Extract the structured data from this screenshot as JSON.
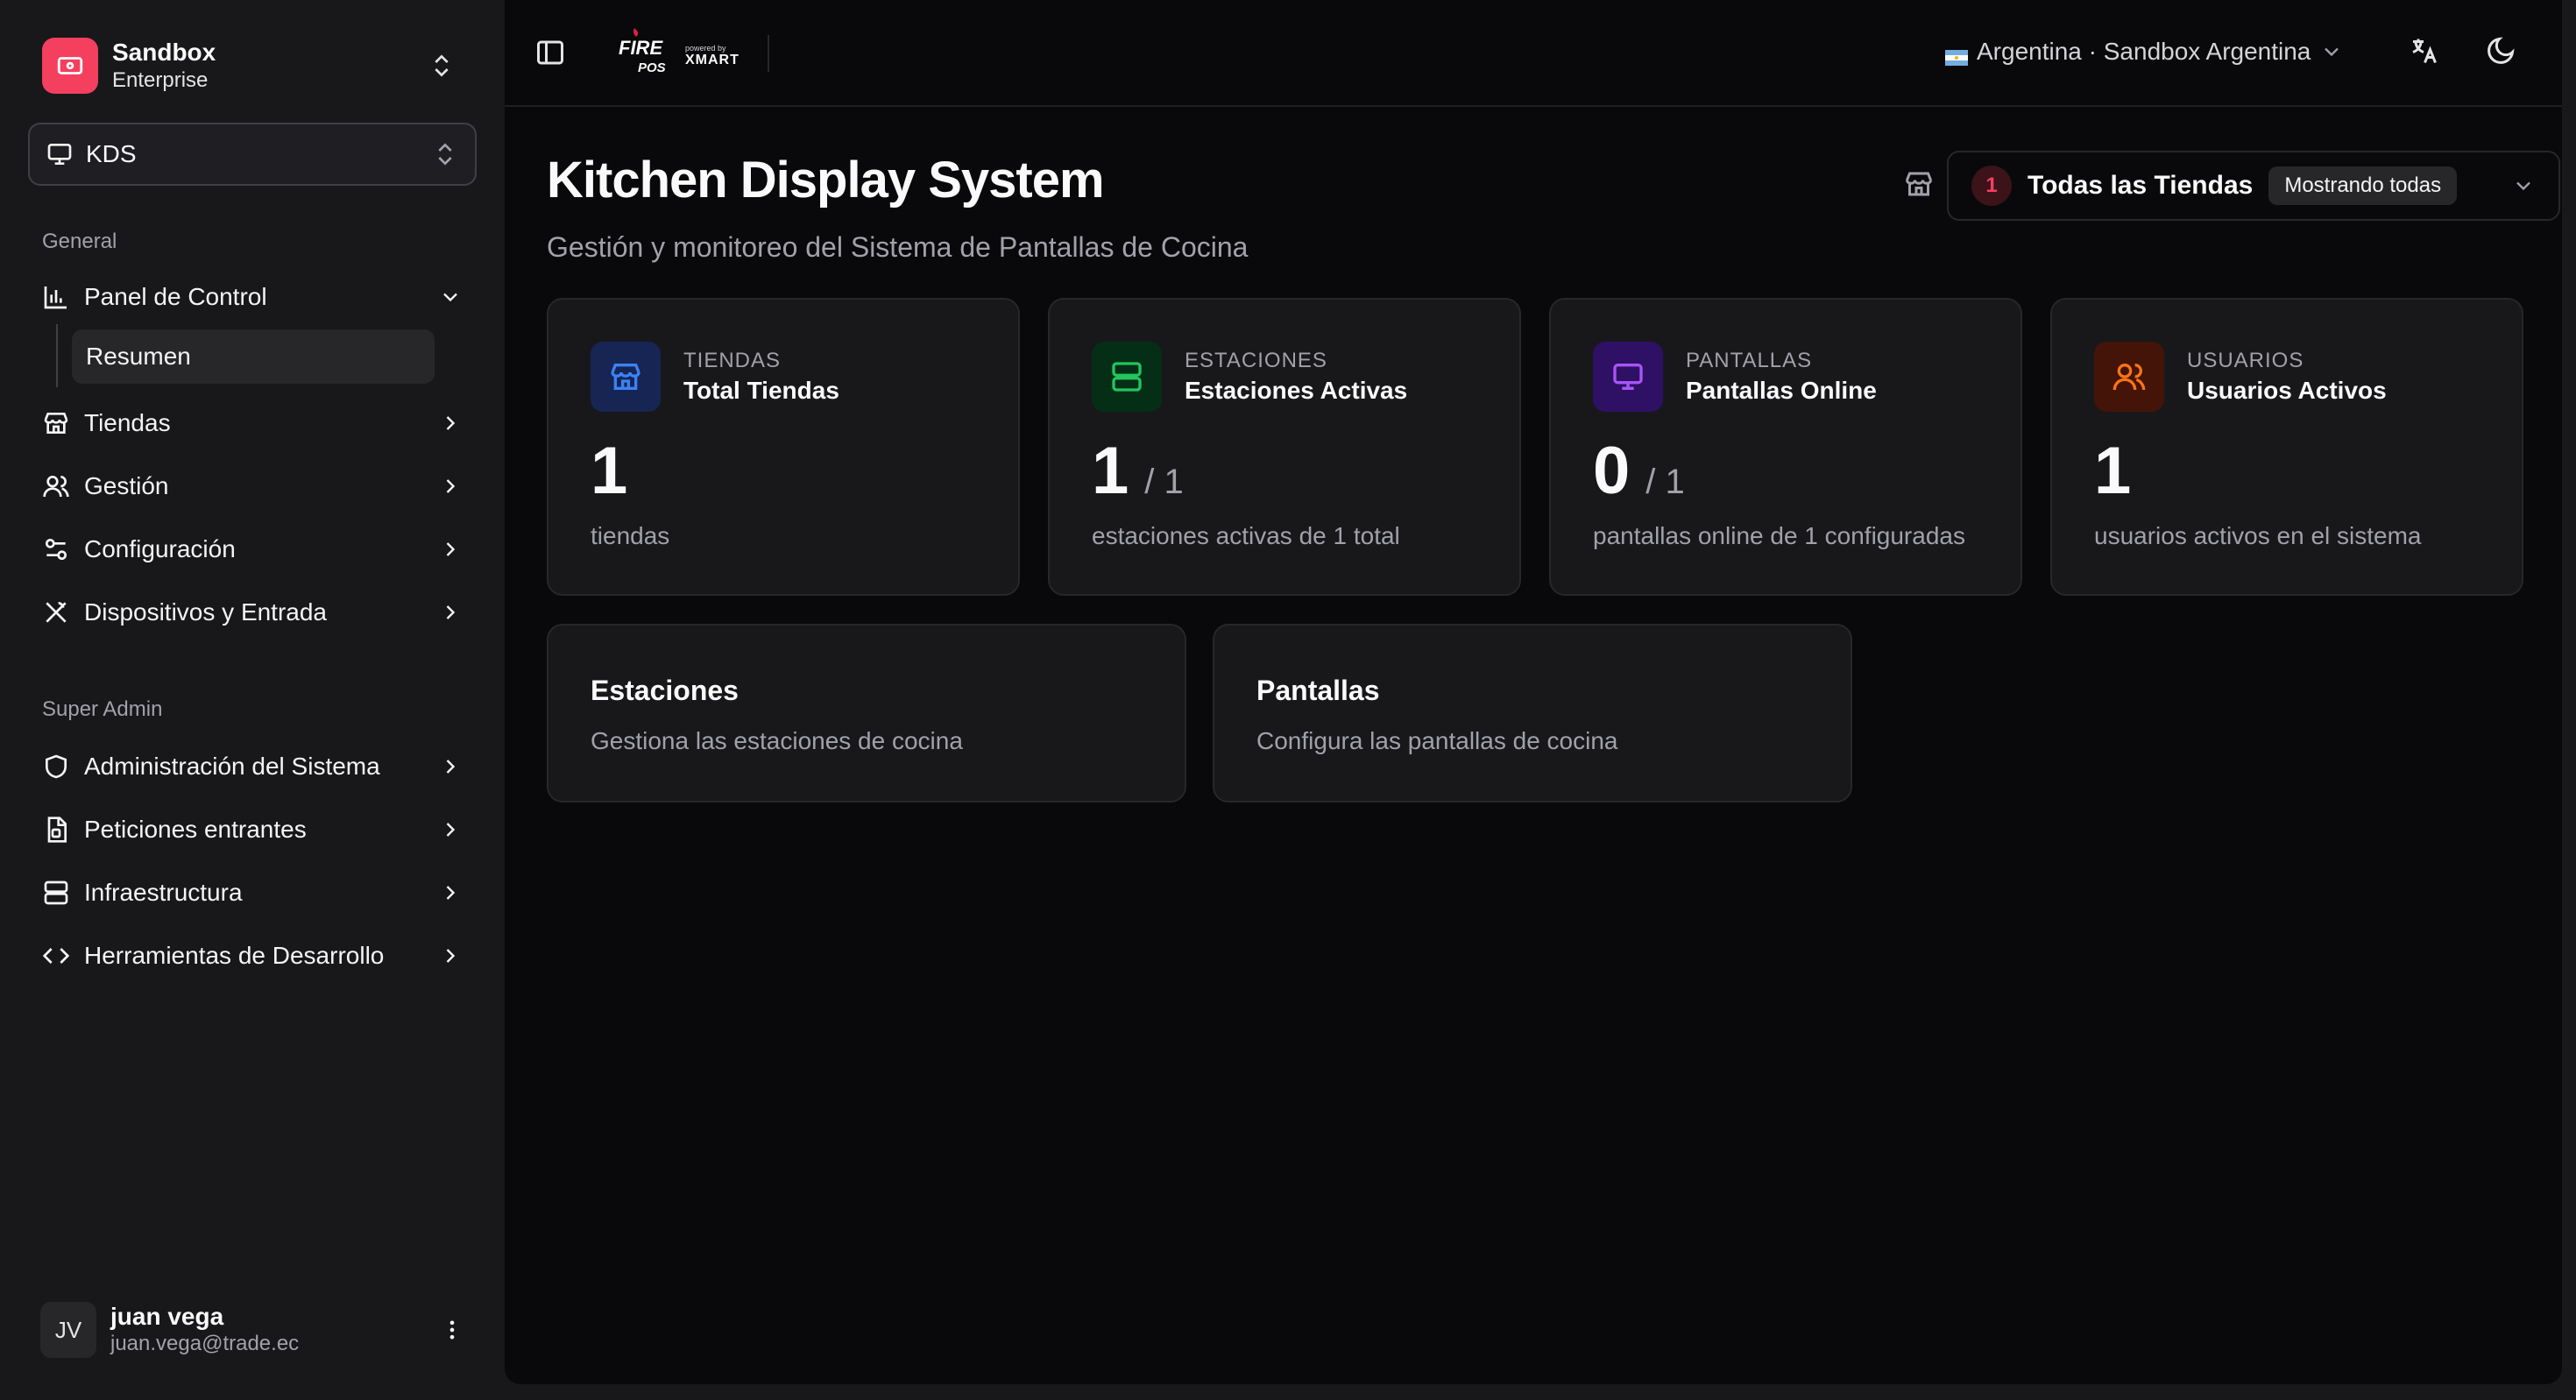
{
  "sidebar": {
    "team": {
      "name": "Sandbox",
      "plan": "Enterprise"
    },
    "module": {
      "label": "KDS"
    },
    "sections": {
      "general": "General",
      "super_admin": "Super Admin"
    },
    "general_items": [
      {
        "label": "Panel de Control",
        "icon": "bar-chart-icon"
      },
      {
        "label": "Tiendas",
        "icon": "store-icon"
      },
      {
        "label": "Gestión",
        "icon": "users-icon"
      },
      {
        "label": "Configuración",
        "icon": "sliders-icon"
      },
      {
        "label": "Dispositivos y Entrada",
        "icon": "utensils-icon"
      }
    ],
    "subitem": "Resumen",
    "admin_items": [
      {
        "label": "Administración del Sistema",
        "icon": "shield-icon"
      },
      {
        "label": "Peticiones entrantes",
        "icon": "file-icon"
      },
      {
        "label": "Infraestructura",
        "icon": "server-icon"
      },
      {
        "label": "Herramientas de Desarrollo",
        "icon": "code-icon"
      }
    ],
    "user": {
      "initials": "JV",
      "name": "juan vega",
      "email": "juan.vega@trade.ec"
    }
  },
  "topbar": {
    "brand": {
      "line1": "FIRE",
      "line2": "POS",
      "powered": "powered by",
      "partner": "XMART"
    },
    "country": "Argentina · Sandbox Argentina"
  },
  "header": {
    "title": "Kitchen Display System",
    "subtitle": "Gestión y monitoreo del Sistema de Pantallas de Cocina",
    "store_filter": {
      "count": "1",
      "label": "Todas las Tiendas",
      "tag": "Mostrando todas"
    }
  },
  "stats": [
    {
      "category": "TIENDAS",
      "title": "Total Tiendas",
      "value": "1",
      "total": "",
      "description": "tiendas",
      "color": "#3b82f6",
      "bg": "#172554"
    },
    {
      "category": "ESTACIONES",
      "title": "Estaciones Activas",
      "value": "1",
      "total": "/ 1",
      "description": "estaciones activas de 1 total",
      "color": "#22c55e",
      "bg": "#052e16"
    },
    {
      "category": "PANTALLAS",
      "title": "Pantallas Online",
      "value": "0",
      "total": "/ 1",
      "description": "pantallas online de 1 configuradas",
      "color": "#a855f7",
      "bg": "#2e1065"
    },
    {
      "category": "USUARIOS",
      "title": "Usuarios Activos",
      "value": "1",
      "total": "",
      "description": "usuarios activos en el sistema",
      "color": "#f97316",
      "bg": "#431407"
    }
  ],
  "nav_cards": [
    {
      "title": "Estaciones",
      "description": "Gestiona las estaciones de cocina"
    },
    {
      "title": "Pantallas",
      "description": "Configura las pantallas de cocina"
    }
  ],
  "colors": {
    "accent": "#f43f5e"
  }
}
